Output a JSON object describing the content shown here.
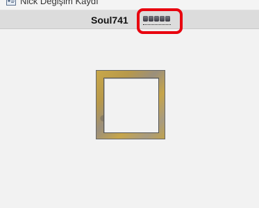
{
  "window": {
    "title": "Nick Değişim Kaydı",
    "icon": "user-card-icon"
  },
  "userbar": {
    "username": "Soul741",
    "masked_value": "●●●●●"
  },
  "colors": {
    "highlight": "#e8000e",
    "frame_gold": "#c9a84a",
    "background": "#f2f2f2"
  }
}
